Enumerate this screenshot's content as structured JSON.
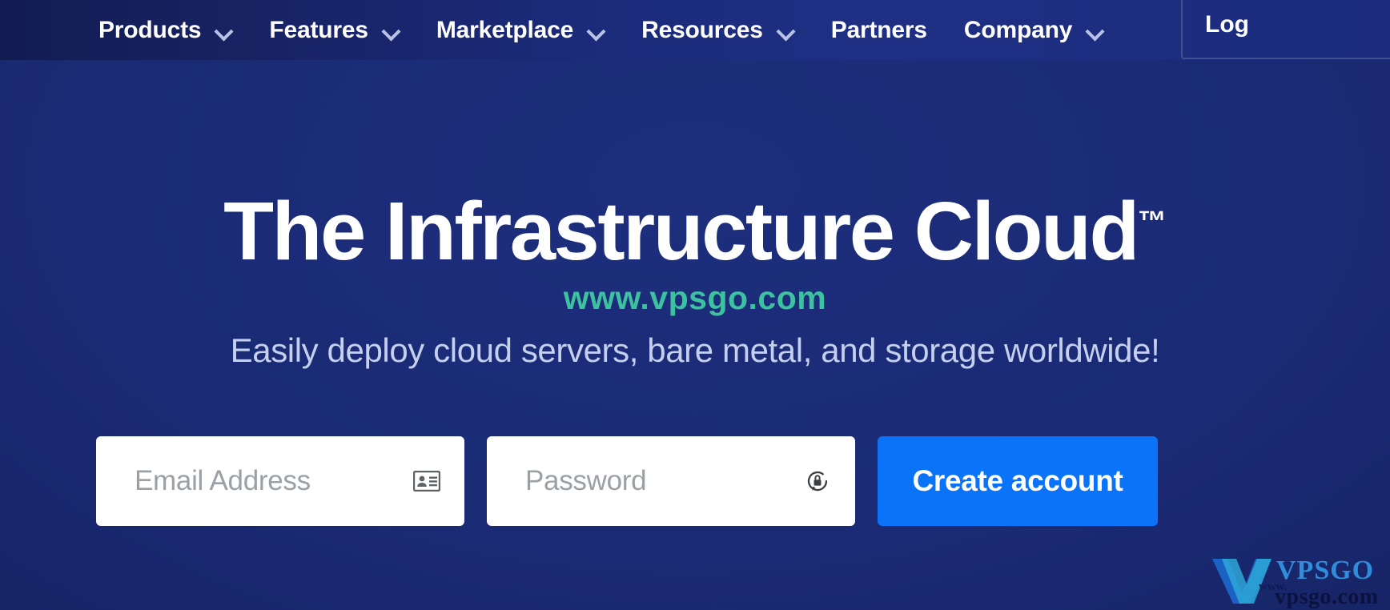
{
  "nav": {
    "items": [
      {
        "label": "Products",
        "has_chevron": true,
        "icon": "chevron-down-icon"
      },
      {
        "label": "Features",
        "has_chevron": true,
        "icon": "chevron-down-icon"
      },
      {
        "label": "Marketplace",
        "has_chevron": true,
        "icon": "chevron-down-icon"
      },
      {
        "label": "Resources",
        "has_chevron": true,
        "icon": "chevron-down-icon"
      },
      {
        "label": "Partners",
        "has_chevron": false,
        "icon": ""
      },
      {
        "label": "Company",
        "has_chevron": true,
        "icon": "chevron-down-icon"
      }
    ],
    "login_label": "Log"
  },
  "hero": {
    "headline": "The Infrastructure Cloud",
    "headline_trademark": "™",
    "subheadline": "Easily deploy cloud servers, bare metal, and storage worldwide!"
  },
  "signup": {
    "email": {
      "value": "",
      "placeholder": "Email Address",
      "icon": "contact-card-icon"
    },
    "password": {
      "value": "",
      "placeholder": "Password",
      "icon": "password-generate-icon"
    },
    "submit_label": "Create account"
  },
  "watermark": {
    "overlay_text": "www.vpsgo.com",
    "overlay_color": "#3dc2a0",
    "logo_word": "VPSGO",
    "logo_url_small": "www.",
    "logo_url_big": "vpsgo.com"
  },
  "colors": {
    "background_navy": "#1a2a74",
    "nav_background": "#1e2f84",
    "primary_button": "#0a73f7",
    "headline_white": "#ffffff",
    "subheadline_lavender": "#c5cfee",
    "placeholder_gray": "#9aa0a6",
    "chevron_gray": "#b9c2e6"
  }
}
